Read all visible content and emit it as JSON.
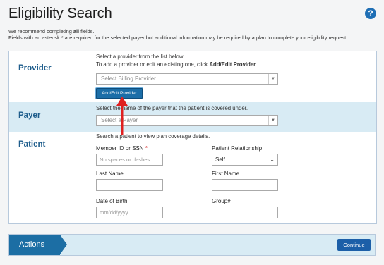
{
  "page": {
    "title": "Eligibility Search",
    "help_icon": "?",
    "intro_line1_pre": "We recommend completing ",
    "intro_line1_bold": "all",
    "intro_line1_post": " fields.",
    "intro_line2": "Fields with an asterisk * are required for the selected payer but additional information may be required by a plan to complete your eligibility request."
  },
  "provider": {
    "label": "Provider",
    "help1": "Select a provider from the list below.",
    "help2_pre": "To add a provider or edit an existing one, click ",
    "help2_bold": "Add/Edit Provider",
    "help2_post": ".",
    "select_placeholder": "Select Billing Provider",
    "add_edit_button": "Add/Edit Provider"
  },
  "payer": {
    "label": "Payer",
    "help": "Select the name of the payer that the patient is covered under.",
    "select_placeholder": "Select a Payer"
  },
  "patient": {
    "label": "Patient",
    "help": "Search a patient to view plan coverage details.",
    "member_id_label": "Member ID or SSN",
    "required_mark": "*",
    "member_id_placeholder": "No spaces or dashes",
    "relationship_label": "Patient Relationship",
    "relationship_value": "Self",
    "last_name_label": "Last Name",
    "first_name_label": "First Name",
    "dob_label": "Date of Birth",
    "dob_placeholder": "mm/dd/yyyy",
    "group_label": "Group#"
  },
  "actions": {
    "label": "Actions",
    "continue_button": "Continue"
  },
  "colors": {
    "accent": "#1c6ea4",
    "section_highlight": "#d8ebf4",
    "annotation_arrow": "#e02020"
  }
}
